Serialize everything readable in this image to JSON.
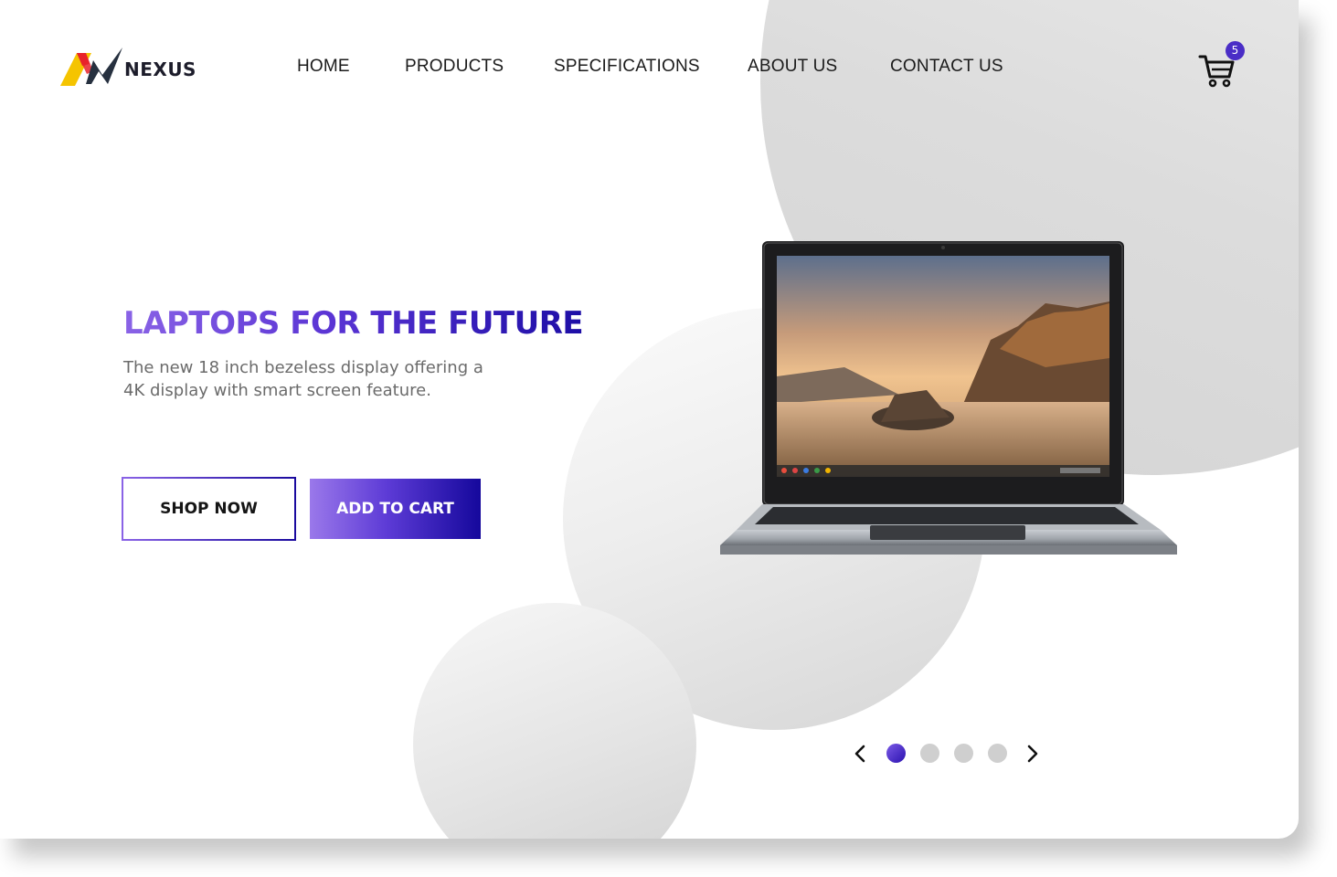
{
  "brand": {
    "name": "NEXUS",
    "logo_icon": "nexus-n-logo-icon"
  },
  "nav": {
    "items": [
      {
        "label": "HOME"
      },
      {
        "label": "PRODUCTS"
      },
      {
        "label": "SPECIFICATIONS"
      },
      {
        "label": "ABOUT US"
      },
      {
        "label": "CONTACT US"
      }
    ]
  },
  "cart": {
    "icon": "shopping-cart-icon",
    "badge_count": "5"
  },
  "hero": {
    "title": "LAPTOPS FOR THE FUTURE",
    "description": "The new 18 inch bezeless display offering a 4K display with smart screen feature.",
    "shop_now_label": "SHOP NOW",
    "add_to_cart_label": "ADD TO CART",
    "product_image": "laptop-product-image"
  },
  "carousel": {
    "prev_icon": "chevron-left-icon",
    "next_icon": "chevron-right-icon",
    "slide_count": 4,
    "active_slide": 1
  },
  "colors": {
    "accent_start": "#8a63e6",
    "accent_end": "#1a0a9e",
    "dot_inactive": "#cfcfcf"
  }
}
